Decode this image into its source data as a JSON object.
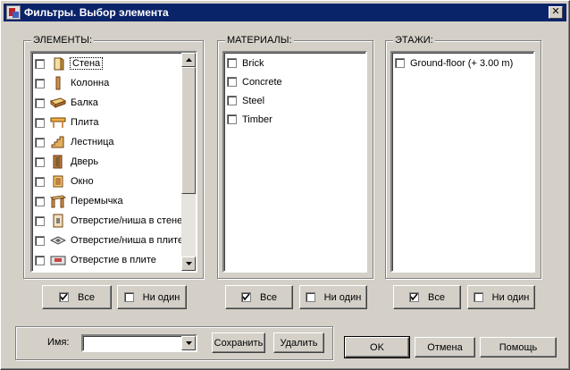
{
  "window": {
    "title": "Фильтры. Выбор элемента"
  },
  "elements": {
    "label": "ЭЛЕМЕНТЫ:",
    "items": [
      {
        "label": "Стена",
        "icon": "wall-icon"
      },
      {
        "label": "Колонна",
        "icon": "column-icon"
      },
      {
        "label": "Балка",
        "icon": "beam-icon"
      },
      {
        "label": "Плита",
        "icon": "slab-icon"
      },
      {
        "label": "Лестница",
        "icon": "stair-icon"
      },
      {
        "label": "Дверь",
        "icon": "door-icon"
      },
      {
        "label": "Окно",
        "icon": "window-icon"
      },
      {
        "label": "Перемычка",
        "icon": "lintel-icon"
      },
      {
        "label": "Отверстие/ниша в стене",
        "icon": "wall-opening-icon"
      },
      {
        "label": "Отверстие/ниша в плите",
        "icon": "slab-niche-icon"
      },
      {
        "label": "Отверстие в плите",
        "icon": "slab-opening-icon"
      }
    ],
    "all_label": "Все",
    "none_label": "Ни один"
  },
  "materials": {
    "label": "МАТЕРИАЛЫ:",
    "items": [
      "Brick",
      "Concrete",
      "Steel",
      "Timber"
    ],
    "all_label": "Все",
    "none_label": "Ни один"
  },
  "floors": {
    "label": "ЭТАЖИ:",
    "items": [
      "Ground-floor (+ 3.00 m)"
    ],
    "all_label": "Все",
    "none_label": "Ни один"
  },
  "name_row": {
    "label": "Имя:",
    "value": "",
    "save_label": "Сохранить",
    "delete_label": "Удалить"
  },
  "footer": {
    "ok_label": "OK",
    "cancel_label": "Отмена",
    "help_label": "Помощь"
  }
}
